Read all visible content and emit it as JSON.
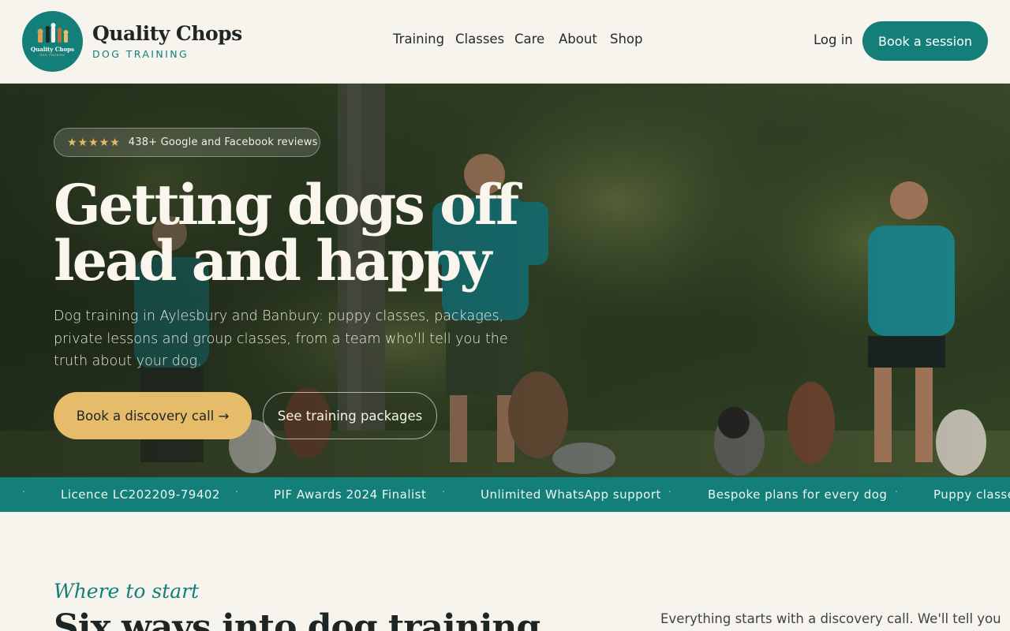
{
  "brand": {
    "name": "Quality Chops",
    "subtitle": "DOG TRAINING",
    "badge_text": "Quality Chops",
    "badge_sub": "DOG TRAINING"
  },
  "nav": {
    "items": [
      "Training",
      "Classes",
      "Care",
      "About",
      "Shop"
    ],
    "login_label": "Log in",
    "cta_label": "Book a session"
  },
  "hero": {
    "stars": "★★★★★",
    "reviews": "438+ Google and Facebook reviews",
    "title_line1": "Getting dogs off",
    "title_line2": "lead and happy",
    "description": "Dog training in Aylesbury and Banbury: puppy classes, packages, private lessons and group classes, from a team who'll tell you the truth about your dog.",
    "primary_cta": "Book a discovery call →",
    "secondary_cta": "See training packages"
  },
  "marquee": {
    "items": [
      "Licence LC202209-79402",
      "PIF Awards 2024 Finalist",
      "Unlimited WhatsApp support",
      "Bespoke plans for every dog",
      "Puppy classes"
    ],
    "separator": "·"
  },
  "section": {
    "eyebrow": "Where to start",
    "title": "Six ways into dog training",
    "aside": "Everything starts with a discovery call. We'll tell you"
  },
  "colors": {
    "accent": "#137f78",
    "gold": "#e6bb6a",
    "background": "#f7f4ee"
  }
}
